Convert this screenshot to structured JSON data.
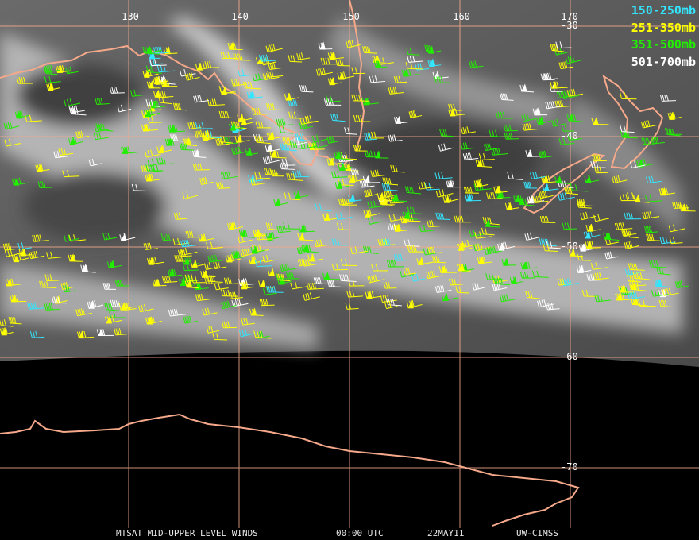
{
  "map": {
    "lon_labels": [
      "-130",
      "-140",
      "-150",
      "-160",
      "-170"
    ],
    "lat_labels": [
      "-30",
      "-40",
      "-50",
      "-60",
      "-70"
    ],
    "coastline_color": "#f5a98a",
    "grid_color": "#f5a98a"
  },
  "legend": [
    {
      "label": "150-250mb",
      "color": "#33e6ff"
    },
    {
      "label": "251-350mb",
      "color": "#ffff00"
    },
    {
      "label": "351-500mb",
      "color": "#22ee00"
    },
    {
      "label": "501-700mb",
      "color": "#ffffff"
    }
  ],
  "footer": {
    "product": "MTSAT MID-UPPER LEVEL WINDS",
    "time": "00:00 UTC",
    "date": "22MAY11",
    "credit": "UW-CIMSS"
  }
}
